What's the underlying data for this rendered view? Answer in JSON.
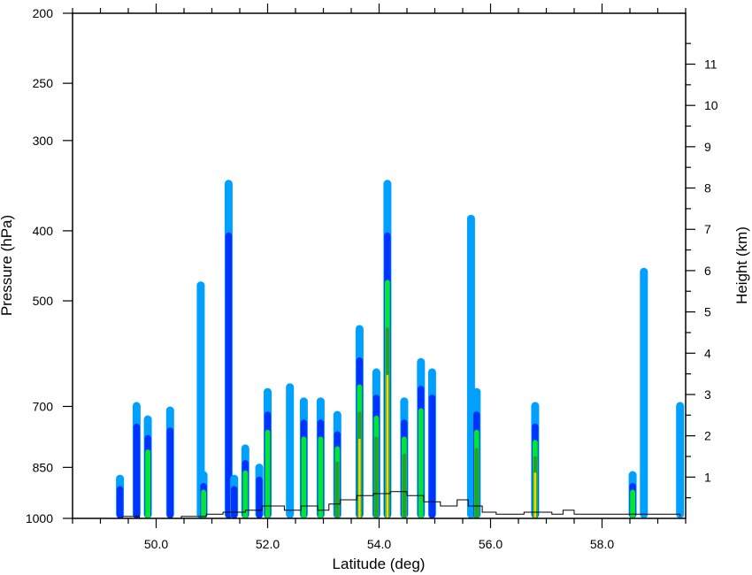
{
  "chart_data": {
    "type": "contour",
    "xlabel": "Latitude (deg)",
    "ylabel_left": "Pressure (hPa)",
    "ylabel_right": "Height (km)",
    "x_range": [
      48.5,
      59.5
    ],
    "y_range_pressure": [
      1000,
      200
    ],
    "y_scale": "log-pressure",
    "x_ticks": [
      {
        "value": 50.0,
        "label": "50.0"
      },
      {
        "value": 52.0,
        "label": "52.0"
      },
      {
        "value": 54.0,
        "label": "54.0"
      },
      {
        "value": 56.0,
        "label": "56.0"
      },
      {
        "value": 58.0,
        "label": "58.0"
      }
    ],
    "left_ticks": [
      {
        "value": 200,
        "label": "200"
      },
      {
        "value": 250,
        "label": "250"
      },
      {
        "value": 300,
        "label": "300"
      },
      {
        "value": 400,
        "label": "400"
      },
      {
        "value": 500,
        "label": "500"
      },
      {
        "value": 700,
        "label": "700"
      },
      {
        "value": 850,
        "label": "850"
      },
      {
        "value": 1000,
        "label": "1000"
      }
    ],
    "right_ticks": [
      {
        "value": 1,
        "label": "1"
      },
      {
        "value": 2,
        "label": "2"
      },
      {
        "value": 3,
        "label": "3"
      },
      {
        "value": 4,
        "label": "4"
      },
      {
        "value": 5,
        "label": "5"
      },
      {
        "value": 6,
        "label": "6"
      },
      {
        "value": 7,
        "label": "7"
      },
      {
        "value": 8,
        "label": "8"
      },
      {
        "value": 9,
        "label": "9"
      },
      {
        "value": 10,
        "label": "10"
      },
      {
        "value": 11,
        "label": "11"
      }
    ],
    "level_colors": [
      "#00a0ff",
      "#0032ff",
      "#00e632",
      "#28a028",
      "#ffd200"
    ],
    "columns": [
      {
        "lat": 49.35,
        "top": 870,
        "level": 1
      },
      {
        "lat": 49.65,
        "top": 690,
        "level": 1
      },
      {
        "lat": 49.85,
        "top": 720,
        "level": 2
      },
      {
        "lat": 50.25,
        "top": 700,
        "level": 1
      },
      {
        "lat": 50.8,
        "top": 470,
        "level": 0
      },
      {
        "lat": 50.85,
        "top": 860,
        "level": 2
      },
      {
        "lat": 51.3,
        "top": 340,
        "level": 1
      },
      {
        "lat": 51.4,
        "top": 870,
        "level": 1
      },
      {
        "lat": 51.6,
        "top": 790,
        "level": 2
      },
      {
        "lat": 51.85,
        "top": 840,
        "level": 1
      },
      {
        "lat": 52.0,
        "top": 660,
        "level": 2
      },
      {
        "lat": 52.4,
        "top": 650,
        "level": 0
      },
      {
        "lat": 52.65,
        "top": 680,
        "level": 2
      },
      {
        "lat": 52.95,
        "top": 680,
        "level": 2
      },
      {
        "lat": 53.25,
        "top": 710,
        "level": 3
      },
      {
        "lat": 53.65,
        "top": 540,
        "level": 4
      },
      {
        "lat": 53.95,
        "top": 620,
        "level": 3
      },
      {
        "lat": 54.15,
        "top": 340,
        "level": 4
      },
      {
        "lat": 54.45,
        "top": 680,
        "level": 3
      },
      {
        "lat": 54.75,
        "top": 600,
        "level": 2
      },
      {
        "lat": 54.95,
        "top": 620,
        "level": 1
      },
      {
        "lat": 55.65,
        "top": 380,
        "level": 0
      },
      {
        "lat": 55.75,
        "top": 660,
        "level": 3
      },
      {
        "lat": 56.8,
        "top": 690,
        "level": 4
      },
      {
        "lat": 58.55,
        "top": 860,
        "level": 2
      },
      {
        "lat": 58.75,
        "top": 450,
        "level": 0
      },
      {
        "lat": 59.4,
        "top": 690,
        "level": 0
      }
    ],
    "terrain_km": [
      {
        "lat": 49.25,
        "h": 0.0
      },
      {
        "lat": 49.4,
        "h": 0.05
      },
      {
        "lat": 49.7,
        "h": 0.0
      },
      {
        "lat": 50.45,
        "h": 0.05
      },
      {
        "lat": 50.9,
        "h": 0.1
      },
      {
        "lat": 51.2,
        "h": 0.15
      },
      {
        "lat": 51.6,
        "h": 0.2
      },
      {
        "lat": 51.9,
        "h": 0.3
      },
      {
        "lat": 52.3,
        "h": 0.2
      },
      {
        "lat": 52.6,
        "h": 0.3
      },
      {
        "lat": 52.9,
        "h": 0.2
      },
      {
        "lat": 53.1,
        "h": 0.35
      },
      {
        "lat": 53.3,
        "h": 0.45
      },
      {
        "lat": 53.6,
        "h": 0.55
      },
      {
        "lat": 53.9,
        "h": 0.6
      },
      {
        "lat": 54.2,
        "h": 0.65
      },
      {
        "lat": 54.5,
        "h": 0.55
      },
      {
        "lat": 54.8,
        "h": 0.4
      },
      {
        "lat": 55.1,
        "h": 0.3
      },
      {
        "lat": 55.4,
        "h": 0.45
      },
      {
        "lat": 55.6,
        "h": 0.3
      },
      {
        "lat": 55.85,
        "h": 0.15
      },
      {
        "lat": 56.1,
        "h": 0.1
      },
      {
        "lat": 56.6,
        "h": 0.15
      },
      {
        "lat": 57.1,
        "h": 0.1
      },
      {
        "lat": 57.3,
        "h": 0.2
      },
      {
        "lat": 57.5,
        "h": 0.1
      },
      {
        "lat": 58.0,
        "h": 0.1
      },
      {
        "lat": 59.4,
        "h": 0.05
      }
    ]
  }
}
